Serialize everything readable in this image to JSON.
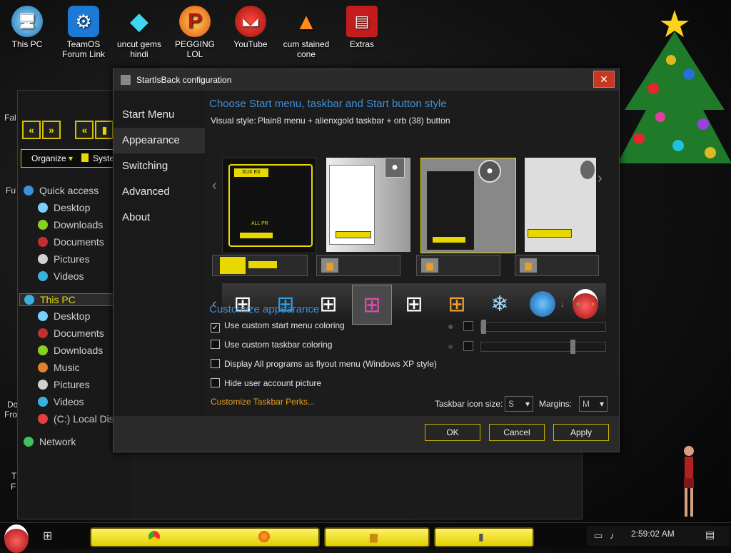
{
  "desktop": {
    "icons": [
      {
        "label": "This PC",
        "icon": "monitor-icon"
      },
      {
        "label": "TeamOS Forum Link",
        "icon": "gear-icon"
      },
      {
        "label": "uncut gems hindi",
        "icon": "diamond-icon"
      },
      {
        "label": "PEGGING LOL",
        "icon": "p-logo-icon"
      },
      {
        "label": "YouTube",
        "icon": "angry-bird-icon"
      },
      {
        "label": "cum stained cone",
        "icon": "traffic-cone-icon"
      },
      {
        "label": "Extras",
        "icon": "gift-box-icon"
      }
    ],
    "partial_labels": [
      "Fal",
      "Fu",
      "Do",
      "Fro",
      "T",
      "F"
    ]
  },
  "explorer": {
    "organize": "Organize",
    "system": "Syste",
    "tree": [
      {
        "label": "Quick access",
        "icon": "star-icon",
        "level": 0
      },
      {
        "label": "Desktop",
        "icon": "desktop-icon",
        "level": 1
      },
      {
        "label": "Downloads",
        "icon": "downloads-icon",
        "level": 1
      },
      {
        "label": "Documents",
        "icon": "documents-icon",
        "level": 1
      },
      {
        "label": "Pictures",
        "icon": "pictures-icon",
        "level": 1
      },
      {
        "label": "Videos",
        "icon": "videos-icon",
        "level": 1
      },
      {
        "label": "This PC",
        "icon": "this-pc-icon",
        "level": 0
      },
      {
        "label": "Desktop",
        "icon": "desktop-icon",
        "level": 1
      },
      {
        "label": "Documents",
        "icon": "documents-icon",
        "level": 1
      },
      {
        "label": "Downloads",
        "icon": "downloads-icon",
        "level": 1
      },
      {
        "label": "Music",
        "icon": "music-icon",
        "level": 1
      },
      {
        "label": "Pictures",
        "icon": "pictures-icon",
        "level": 1
      },
      {
        "label": "Videos",
        "icon": "videos-icon",
        "level": 1
      },
      {
        "label": "(C:) Local Dis",
        "icon": "drive-icon",
        "level": 1
      },
      {
        "label": "Network",
        "icon": "network-icon",
        "level": 0
      }
    ]
  },
  "dialog": {
    "title": "StartIsBack configuration",
    "close": "✕",
    "nav": [
      "Start Menu",
      "Appearance",
      "Switching",
      "Advanced",
      "About"
    ],
    "selected_nav": "Appearance",
    "heading": "Choose Start menu, taskbar and Start button style",
    "visual_style_label": "Visual style:",
    "visual_style_value": "Plain8 menu + alienxgold taskbar + orb (38) button",
    "menu_preview_text1": "XUX EX",
    "menu_preview_text2": "ALL PR",
    "prev_arrow": "‹",
    "next_arrow": "›",
    "customize_heading": "Customize appearance",
    "checkboxes": [
      {
        "label": "Use custom start menu coloring",
        "checked": true
      },
      {
        "label": "Use custom taskbar coloring",
        "checked": false
      },
      {
        "label": "Display All programs as flyout menu (Windows XP style)",
        "checked": false
      },
      {
        "label": "Hide user account picture",
        "checked": false
      }
    ],
    "slider1_level": 0.0,
    "slider2_level": 0.75,
    "perks_link": "Customize Taskbar Perks...",
    "icon_size_label": "Taskbar icon size:",
    "icon_size_value": "S",
    "margins_label": "Margins:",
    "margins_value": "M",
    "ok": "OK",
    "cancel": "Cancel",
    "apply": "Apply",
    "tool_icons": [
      "↓",
      "+",
      "▫"
    ]
  },
  "taskbar": {
    "clock": "2:59:02 AM"
  },
  "colors": {
    "accent_yellow": "#e8d800",
    "heading_blue": "#3d8fd9",
    "link_orange": "#e8a020",
    "close_red": "#c8371f"
  }
}
